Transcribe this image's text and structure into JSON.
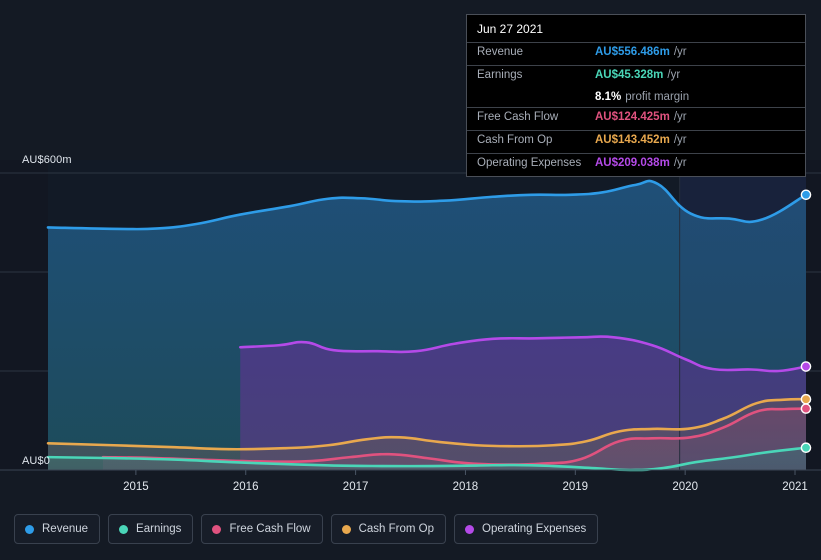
{
  "axes": {
    "y_top_label": "AU$600m",
    "y_zero_label": "AU$0",
    "x_ticks": [
      "2015",
      "2016",
      "2017",
      "2018",
      "2019",
      "2020",
      "2021"
    ]
  },
  "tooltip": {
    "date": "Jun 27 2021",
    "rows": [
      {
        "name": "Revenue",
        "value": "AU$556.486m",
        "unit": "/yr",
        "color": "#2e9ce8"
      },
      {
        "name": "Earnings",
        "value": "AU$45.328m",
        "unit": "/yr",
        "color": "#4ad6b8"
      },
      {
        "name": "Free Cash Flow",
        "value": "AU$124.425m",
        "unit": "/yr",
        "color": "#e0527f"
      },
      {
        "name": "Cash From Op",
        "value": "AU$143.452m",
        "unit": "/yr",
        "color": "#e8a84e"
      },
      {
        "name": "Operating Expenses",
        "value": "AU$209.038m",
        "unit": "/yr",
        "color": "#b44ae8"
      }
    ],
    "profit_margin_value": "8.1%",
    "profit_margin_text": "profit margin"
  },
  "legend": [
    {
      "label": "Revenue",
      "color": "#2e9ce8"
    },
    {
      "label": "Earnings",
      "color": "#4ad6b8"
    },
    {
      "label": "Free Cash Flow",
      "color": "#e0527f"
    },
    {
      "label": "Cash From Op",
      "color": "#e8a84e"
    },
    {
      "label": "Operating Expenses",
      "color": "#b44ae8"
    }
  ],
  "chart_data": {
    "type": "area",
    "title": "",
    "xlabel": "",
    "ylabel": "AU$",
    "currency": "AU$",
    "units": "millions",
    "ylim": [
      0,
      600
    ],
    "y_gridlines": [
      0,
      200,
      400,
      600
    ],
    "grid": true,
    "legend_position": "bottom-left",
    "x": [
      "2015",
      "2016",
      "2017",
      "2018",
      "2019",
      "2020",
      "2021"
    ],
    "x_range": [
      "2014.70",
      "2021.60"
    ],
    "forecast_boundary": "2020.45",
    "series": [
      {
        "name": "Revenue",
        "color": "#2e9ce8",
        "points": [
          {
            "x": 2014.7,
            "y": 490
          },
          {
            "x": 2015.35,
            "y": 487
          },
          {
            "x": 2015.7,
            "y": 488
          },
          {
            "x": 2016.05,
            "y": 497
          },
          {
            "x": 2016.45,
            "y": 516
          },
          {
            "x": 2016.9,
            "y": 533
          },
          {
            "x": 2017.25,
            "y": 548
          },
          {
            "x": 2017.55,
            "y": 549
          },
          {
            "x": 2017.9,
            "y": 543
          },
          {
            "x": 2018.3,
            "y": 544
          },
          {
            "x": 2018.75,
            "y": 552
          },
          {
            "x": 2019.1,
            "y": 556
          },
          {
            "x": 2019.45,
            "y": 556
          },
          {
            "x": 2019.75,
            "y": 561
          },
          {
            "x": 2020.05,
            "y": 576
          },
          {
            "x": 2020.25,
            "y": 578
          },
          {
            "x": 2020.55,
            "y": 518
          },
          {
            "x": 2020.9,
            "y": 508
          },
          {
            "x": 2021.2,
            "y": 506
          },
          {
            "x": 2021.6,
            "y": 556
          }
        ],
        "end_value": 556.486
      },
      {
        "name": "Operating Expenses",
        "color": "#b44ae8",
        "points": [
          {
            "x": 2016.45,
            "y": 248
          },
          {
            "x": 2016.8,
            "y": 252
          },
          {
            "x": 2017.05,
            "y": 258
          },
          {
            "x": 2017.3,
            "y": 242
          },
          {
            "x": 2017.7,
            "y": 240
          },
          {
            "x": 2018.05,
            "y": 240
          },
          {
            "x": 2018.4,
            "y": 255
          },
          {
            "x": 2018.75,
            "y": 265
          },
          {
            "x": 2019.15,
            "y": 266
          },
          {
            "x": 2019.55,
            "y": 268
          },
          {
            "x": 2019.85,
            "y": 268
          },
          {
            "x": 2020.2,
            "y": 252
          },
          {
            "x": 2020.5,
            "y": 224
          },
          {
            "x": 2020.75,
            "y": 204
          },
          {
            "x": 2021.1,
            "y": 203
          },
          {
            "x": 2021.35,
            "y": 200
          },
          {
            "x": 2021.6,
            "y": 209
          }
        ],
        "end_value": 209.038
      },
      {
        "name": "Cash From Op",
        "color": "#e8a84e",
        "points": [
          {
            "x": 2014.7,
            "y": 54
          },
          {
            "x": 2015.3,
            "y": 50
          },
          {
            "x": 2015.85,
            "y": 46
          },
          {
            "x": 2016.35,
            "y": 42
          },
          {
            "x": 2016.85,
            "y": 44
          },
          {
            "x": 2017.25,
            "y": 50
          },
          {
            "x": 2017.6,
            "y": 62
          },
          {
            "x": 2017.9,
            "y": 66
          },
          {
            "x": 2018.25,
            "y": 57
          },
          {
            "x": 2018.6,
            "y": 50
          },
          {
            "x": 2018.95,
            "y": 48
          },
          {
            "x": 2019.3,
            "y": 50
          },
          {
            "x": 2019.6,
            "y": 58
          },
          {
            "x": 2019.9,
            "y": 78
          },
          {
            "x": 2020.2,
            "y": 83
          },
          {
            "x": 2020.55,
            "y": 84
          },
          {
            "x": 2020.85,
            "y": 104
          },
          {
            "x": 2021.15,
            "y": 135
          },
          {
            "x": 2021.4,
            "y": 142
          },
          {
            "x": 2021.6,
            "y": 143
          }
        ],
        "end_value": 143.452
      },
      {
        "name": "Free Cash Flow",
        "color": "#e0527f",
        "points": [
          {
            "x": 2015.2,
            "y": 26
          },
          {
            "x": 2015.7,
            "y": 24
          },
          {
            "x": 2016.2,
            "y": 20
          },
          {
            "x": 2016.7,
            "y": 17
          },
          {
            "x": 2017.1,
            "y": 18
          },
          {
            "x": 2017.45,
            "y": 26
          },
          {
            "x": 2017.8,
            "y": 32
          },
          {
            "x": 2018.15,
            "y": 24
          },
          {
            "x": 2018.5,
            "y": 14
          },
          {
            "x": 2018.85,
            "y": 11
          },
          {
            "x": 2019.2,
            "y": 13
          },
          {
            "x": 2019.55,
            "y": 22
          },
          {
            "x": 2019.9,
            "y": 58
          },
          {
            "x": 2020.2,
            "y": 64
          },
          {
            "x": 2020.55,
            "y": 66
          },
          {
            "x": 2020.85,
            "y": 86
          },
          {
            "x": 2021.15,
            "y": 118
          },
          {
            "x": 2021.4,
            "y": 123
          },
          {
            "x": 2021.6,
            "y": 124
          }
        ],
        "end_value": 124.425
      },
      {
        "name": "Earnings",
        "color": "#4ad6b8",
        "points": [
          {
            "x": 2014.7,
            "y": 26
          },
          {
            "x": 2015.3,
            "y": 24
          },
          {
            "x": 2015.85,
            "y": 21
          },
          {
            "x": 2016.35,
            "y": 16
          },
          {
            "x": 2016.85,
            "y": 12
          },
          {
            "x": 2017.3,
            "y": 9
          },
          {
            "x": 2017.75,
            "y": 8
          },
          {
            "x": 2018.2,
            "y": 8
          },
          {
            "x": 2018.6,
            "y": 9
          },
          {
            "x": 2018.95,
            "y": 10
          },
          {
            "x": 2019.3,
            "y": 8
          },
          {
            "x": 2019.65,
            "y": 4
          },
          {
            "x": 2020.0,
            "y": 0
          },
          {
            "x": 2020.3,
            "y": 4
          },
          {
            "x": 2020.6,
            "y": 16
          },
          {
            "x": 2020.95,
            "y": 26
          },
          {
            "x": 2021.25,
            "y": 36
          },
          {
            "x": 2021.6,
            "y": 45
          }
        ],
        "end_value": 45.328
      }
    ]
  },
  "theme": {
    "page_background": "#141a24",
    "plot_background": "#121722",
    "gridline_color": "#2c3542",
    "forecast_divider": "#252e3d"
  }
}
